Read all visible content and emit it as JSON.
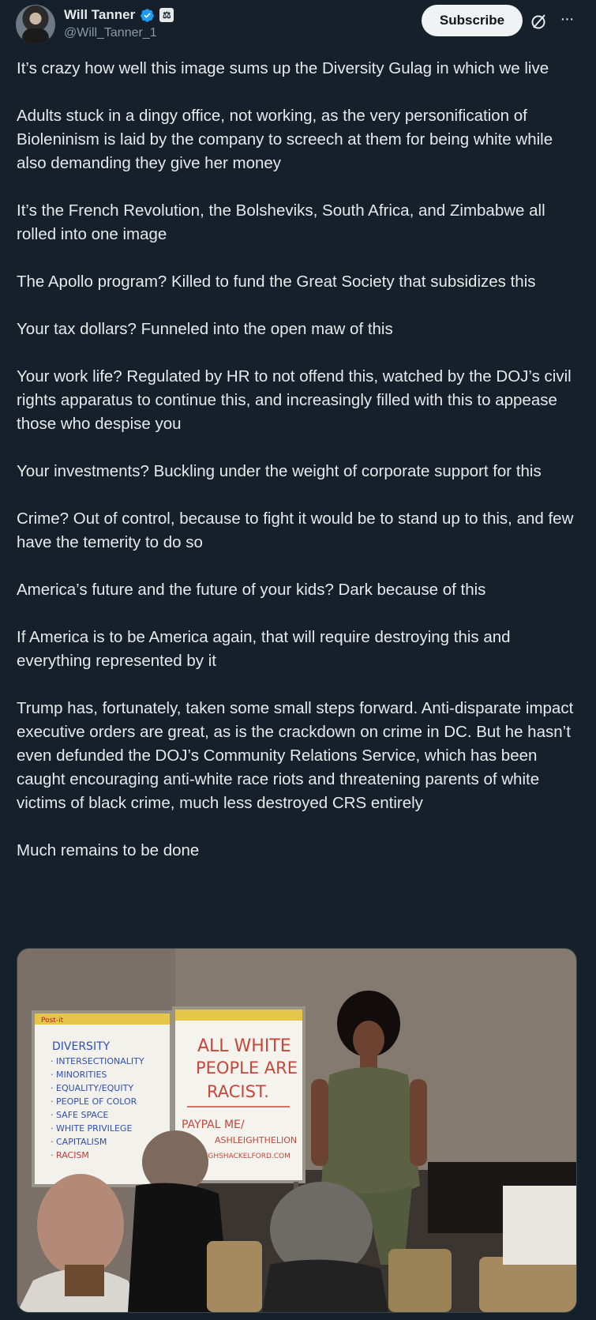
{
  "author": {
    "name": "Will Tanner",
    "handle": "@Will_Tanner_1",
    "verified": true,
    "avatar_icon": "avatar-photo",
    "affiliation_badge": "affiliation-badge-icon"
  },
  "actions": {
    "subscribe_label": "Subscribe",
    "grok_icon": "grok-icon",
    "more_icon": "more-icon"
  },
  "tweet": {
    "paragraphs": [
      "It’s crazy how well this image sums up the Diversity Gulag in which we live",
      "Adults stuck in a dingy office, not working, as the very personification of Bioleninism is laid by the company to screech at them for being white while also demanding they give her money",
      "It’s the French Revolution, the Bolsheviks, South Africa, and Zimbabwe all rolled into one image",
      "The Apollo program? Killed to fund the Great Society that subsidizes this",
      "Your tax dollars? Funneled into the open maw of this",
      "Your work life? Regulated by HR to not offend this, watched by the DOJ’s civil rights apparatus to continue this, and increasingly filled with this to appease those who despise you",
      "Your investments? Buckling under the weight of corporate support for this",
      "Crime? Out of control, because to fight it would be to stand up to this, and few have the temerity to do so",
      "America’s future and the future of your kids? Dark because of this",
      "If America is to be America again, that will require destroying this and everything represented by it",
      "Trump has, fortunately, taken some small steps forward. Anti-disparate impact executive orders are great, as is the crackdown on crime in DC. But he hasn’t even defunded the DOJ’s Community Relations Service, which has been caught encouraging anti-white race riots and threatening parents of white victims of black crime, much less destroyed CRS entirely",
      "Much remains to be done"
    ]
  },
  "media": {
    "left_board_items": [
      "DIVERSITY",
      "· INTERSECTIONALITY",
      "· MINORITIES",
      "· EQUALITY/EQUITY",
      "· PEOPLE OF COLOR",
      "· SAFE SPACE",
      "· WHITE PRIVILEGE",
      "· CAPITALISM",
      "· RACISM"
    ],
    "right_board_lines": [
      "ALL WHITE",
      "PEOPLE ARE",
      "RACIST.",
      "PAYPAL ME/",
      "ASHLEIGHTHELION",
      "LEIGHSHACKELFORD.COM"
    ],
    "board_header": "Post-it"
  }
}
